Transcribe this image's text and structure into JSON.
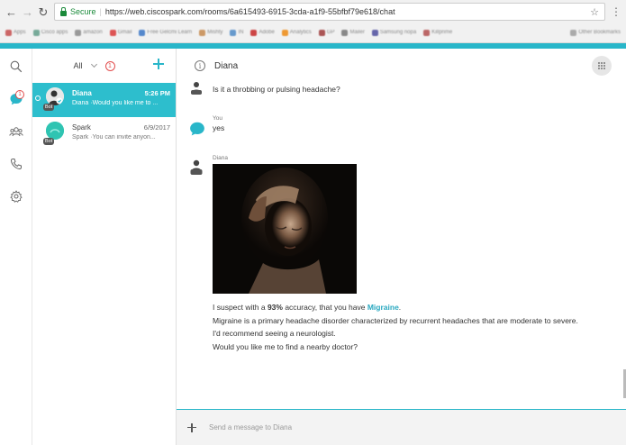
{
  "browser": {
    "secure_label": "Secure",
    "url": "https://web.ciscospark.com/rooms/6a615493-6915-3cda-a1f9-55bfbf79e618/chat",
    "bookmarks": [
      "Apps",
      "Cisco apps",
      "amazon",
      "Gmail",
      "Free Gelcmi Learn",
      "Mishty",
      "IN",
      "Adobe",
      "Analytics",
      "GP",
      "Mailer",
      "Samsung nopa",
      "Killprime"
    ],
    "other_bookmarks": "Other Bookmarks"
  },
  "rail": {
    "chat_badge": "1"
  },
  "rooms_panel": {
    "filter_label": "All",
    "unread_count": "1",
    "rooms": [
      {
        "name": "Diana",
        "time": "5:26 PM",
        "preview": "Diana ·Would you like me to ...",
        "tag": "Bot"
      },
      {
        "name": "Spark",
        "time": "6/9/2017",
        "preview": "Spark ·You can invite anyon...",
        "tag": "Bot"
      }
    ]
  },
  "conversation": {
    "title": "Diana",
    "messages": [
      {
        "sender": "",
        "text": "Is it a throbbing or pulsing headache?",
        "tag": "Bot"
      },
      {
        "sender": "You",
        "text": "yes"
      },
      {
        "sender": "Diana",
        "tag": "Bot",
        "line1_prefix": "I suspect with a ",
        "line1_percent": "93%",
        "line1_middle": " accuracy, that you have ",
        "line1_condition": "Migraine",
        "line1_suffix": ".",
        "line2": "Migraine is a primary headache disorder characterized by recurrent headaches that are moderate to severe.",
        "line3": "I'd recommend seeing a neurologist.",
        "line4": "Would you like me to find a nearby doctor?"
      }
    ],
    "composer_placeholder": "Send a message to Diana"
  },
  "colors": {
    "accent": "#29b6c9",
    "active_room": "#2dbecd",
    "badge": "#e24c4c"
  }
}
